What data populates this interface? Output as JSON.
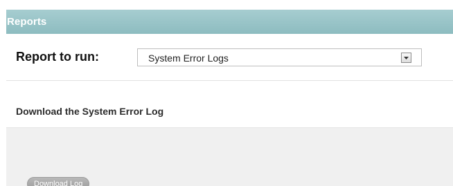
{
  "header": {
    "title": "Reports",
    "color": "#95c2c5"
  },
  "report_picker": {
    "label": "Report to run:",
    "selected": "System Error Logs",
    "dropdown_icon": "chevron-down-icon"
  },
  "section": {
    "title": "Download the System Error Log"
  },
  "actions": {
    "download_label": "Download Log"
  }
}
